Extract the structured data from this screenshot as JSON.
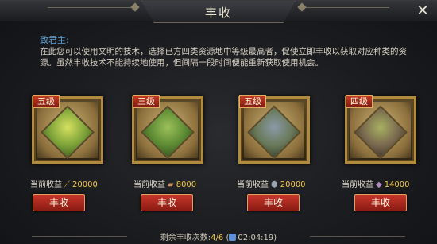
{
  "window": {
    "title": "丰收",
    "close_label": "✕"
  },
  "intro": {
    "greeting": "致君主:",
    "description": "在此您可以使用文明的技术，选择已方四类资源地中等级最高者，促使立即丰收以获取对应种类的资源。虽然丰收技术不能持续地使用，但间隔一段时间便能重新获取使用机会。"
  },
  "cards": [
    {
      "tier": "五级",
      "income_label": "当前收益",
      "resource_icon": "food-icon",
      "income_value": "20000",
      "button_label": "丰收"
    },
    {
      "tier": "三级",
      "income_label": "当前收益",
      "resource_icon": "wood-icon",
      "income_value": "8000",
      "button_label": "丰收"
    },
    {
      "tier": "五级",
      "income_label": "当前收益",
      "resource_icon": "stone-icon",
      "income_value": "20000",
      "button_label": "丰收"
    },
    {
      "tier": "四级",
      "income_label": "当前收益",
      "resource_icon": "iron-icon",
      "income_value": "14000",
      "button_label": "丰收"
    }
  ],
  "footer": {
    "remaining_label": "剩余丰收次数:",
    "remaining_value": "4/6",
    "timer_open": "(",
    "timer": "02:04:19",
    "timer_close": ")"
  },
  "colors": {
    "accent_gold": "#f2c94c",
    "greeting_blue": "#5fa3d6",
    "button_red": "#c8362a"
  }
}
